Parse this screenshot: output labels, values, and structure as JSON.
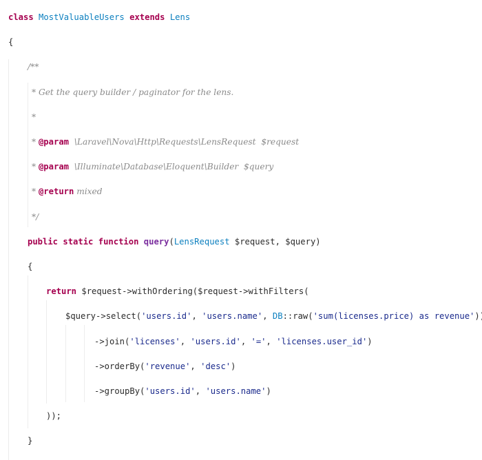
{
  "code": {
    "language": "php",
    "lines": [
      {
        "tokens": [
          {
            "t": "class",
            "k": "kw"
          },
          {
            "t": " ",
            "k": "plain"
          },
          {
            "t": "MostValuableUsers",
            "k": "cls"
          },
          {
            "t": " ",
            "k": "plain"
          },
          {
            "t": "extends",
            "k": "kw"
          },
          {
            "t": " ",
            "k": "plain"
          },
          {
            "t": "Lens",
            "k": "cls"
          }
        ]
      },
      {
        "tokens": [
          {
            "t": "{",
            "k": "plain"
          }
        ]
      },
      {
        "tokens": [
          {
            "t": "/**",
            "k": "cm"
          }
        ]
      },
      {
        "tokens": [
          {
            "t": "* Get the query builder / paginator for the lens.",
            "k": "cm"
          }
        ]
      },
      {
        "tokens": [
          {
            "t": "*",
            "k": "cm"
          }
        ]
      },
      {
        "tokens": [
          {
            "t": "* ",
            "k": "cm"
          },
          {
            "t": "@param",
            "k": "tag"
          },
          {
            "t": "  \\Laravel\\Nova\\Http\\Requests\\LensRequest  $request",
            "k": "cm"
          }
        ]
      },
      {
        "tokens": [
          {
            "t": "* ",
            "k": "cm"
          },
          {
            "t": "@param",
            "k": "tag"
          },
          {
            "t": "  \\Illuminate\\Database\\Eloquent\\Builder  $query",
            "k": "cm"
          }
        ]
      },
      {
        "tokens": [
          {
            "t": "* ",
            "k": "cm"
          },
          {
            "t": "@return",
            "k": "tag"
          },
          {
            "t": " mixed",
            "k": "cm"
          }
        ]
      },
      {
        "tokens": [
          {
            "t": "*/",
            "k": "cm"
          }
        ]
      },
      {
        "tokens": [
          {
            "t": "public",
            "k": "kw"
          },
          {
            "t": " ",
            "k": "plain"
          },
          {
            "t": "static",
            "k": "kw"
          },
          {
            "t": " ",
            "k": "plain"
          },
          {
            "t": "function",
            "k": "kw"
          },
          {
            "t": " ",
            "k": "plain"
          },
          {
            "t": "query",
            "k": "fn"
          },
          {
            "t": "(",
            "k": "plain"
          },
          {
            "t": "LensRequest",
            "k": "cls"
          },
          {
            "t": " $request, $query)",
            "k": "plain"
          }
        ]
      },
      {
        "tokens": [
          {
            "t": "{",
            "k": "plain"
          }
        ]
      },
      {
        "tokens": [
          {
            "t": "return",
            "k": "kw"
          },
          {
            "t": " $request->withOrdering($request->withFilters(",
            "k": "plain"
          }
        ]
      },
      {
        "tokens": [
          {
            "t": "$query->select(",
            "k": "plain"
          },
          {
            "t": "'users.id'",
            "k": "str"
          },
          {
            "t": ", ",
            "k": "plain"
          },
          {
            "t": "'users.name'",
            "k": "str"
          },
          {
            "t": ", ",
            "k": "plain"
          },
          {
            "t": "DB",
            "k": "cls"
          },
          {
            "t": "::raw(",
            "k": "plain"
          },
          {
            "t": "'sum(licenses.price) as revenue'",
            "k": "str"
          },
          {
            "t": "))",
            "k": "plain"
          }
        ]
      },
      {
        "tokens": [
          {
            "t": "->join(",
            "k": "plain"
          },
          {
            "t": "'licenses'",
            "k": "str"
          },
          {
            "t": ", ",
            "k": "plain"
          },
          {
            "t": "'users.id'",
            "k": "str"
          },
          {
            "t": ", ",
            "k": "plain"
          },
          {
            "t": "'='",
            "k": "str"
          },
          {
            "t": ", ",
            "k": "plain"
          },
          {
            "t": "'licenses.user_id'",
            "k": "str"
          },
          {
            "t": ")",
            "k": "plain"
          }
        ]
      },
      {
        "tokens": [
          {
            "t": "->orderBy(",
            "k": "plain"
          },
          {
            "t": "'revenue'",
            "k": "str"
          },
          {
            "t": ", ",
            "k": "plain"
          },
          {
            "t": "'desc'",
            "k": "str"
          },
          {
            "t": ")",
            "k": "plain"
          }
        ]
      },
      {
        "tokens": [
          {
            "t": "->groupBy(",
            "k": "plain"
          },
          {
            "t": "'users.id'",
            "k": "str"
          },
          {
            "t": ", ",
            "k": "plain"
          },
          {
            "t": "'users.name'",
            "k": "str"
          },
          {
            "t": ")",
            "k": "plain"
          }
        ]
      },
      {
        "tokens": [
          {
            "t": "));",
            "k": "plain"
          }
        ]
      },
      {
        "tokens": [
          {
            "t": "}",
            "k": "plain"
          }
        ]
      }
    ]
  },
  "colors": {
    "keyword": "#a5004f",
    "class_name": "#0b7fbf",
    "function_name": "#7a2d9e",
    "string": "#1a2a8c",
    "comment": "#8a8a8a",
    "text": "#2b2b2b",
    "background": "#ffffff"
  }
}
